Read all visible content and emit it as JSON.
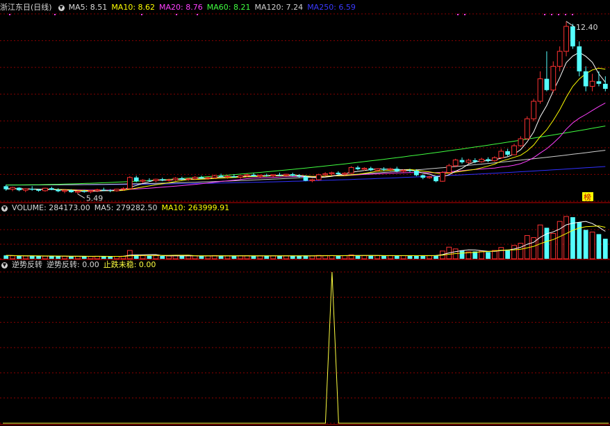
{
  "price_header": {
    "title": "浙江东日(日线)",
    "ma5": "MA5: 8.51",
    "ma10": "MA10: 8.62",
    "ma20": "MA20: 8.76",
    "ma60": "MA60: 8.21",
    "ma120": "MA120: 7.24",
    "ma250": "MA250: 6.59",
    "high_label": "12.40",
    "low_label": "5.49",
    "tag": "榜"
  },
  "volume_header": {
    "volume": "VOLUME: 284173.00",
    "ma5": "MA5: 279282.50",
    "ma10": "MA10: 263999.91"
  },
  "indicator_header": {
    "name": "逆势反转",
    "line1": "逆势反转: 0.00",
    "line2": "止跌未稳: 0.00"
  },
  "colors": {
    "up": "#ff3232",
    "down": "#54ffff",
    "grid": "#8b0000",
    "ma5": "#ffffff",
    "ma10": "#ffff00",
    "ma20": "#ff40ff",
    "ma60": "#40ff40",
    "ma120": "#d0d0d0",
    "ma250": "#3030ff",
    "signal": "#ffff40"
  },
  "chart_data": [
    {
      "type": "candlestick",
      "title": "浙江东日(日线)",
      "ylim": [
        5.2,
        12.7
      ],
      "ohlc": [
        [
          5.8,
          5.86,
          5.62,
          5.68
        ],
        [
          5.68,
          5.78,
          5.6,
          5.75
        ],
        [
          5.74,
          5.76,
          5.6,
          5.64
        ],
        [
          5.64,
          5.72,
          5.56,
          5.7
        ],
        [
          5.7,
          5.8,
          5.62,
          5.66
        ],
        [
          5.66,
          5.7,
          5.58,
          5.62
        ],
        [
          5.62,
          5.74,
          5.58,
          5.72
        ],
        [
          5.72,
          5.78,
          5.64,
          5.66
        ],
        [
          5.66,
          5.72,
          5.56,
          5.6
        ],
        [
          5.6,
          5.66,
          5.52,
          5.64
        ],
        [
          5.64,
          5.68,
          5.54,
          5.56
        ],
        [
          5.56,
          5.62,
          5.49,
          5.6
        ],
        [
          5.6,
          5.66,
          5.54,
          5.58
        ],
        [
          5.58,
          5.64,
          5.52,
          5.62
        ],
        [
          5.62,
          5.7,
          5.56,
          5.66
        ],
        [
          5.66,
          5.74,
          5.6,
          5.64
        ],
        [
          5.64,
          5.68,
          5.56,
          5.62
        ],
        [
          5.62,
          5.7,
          5.58,
          5.68
        ],
        [
          5.68,
          5.76,
          5.62,
          5.7
        ],
        [
          5.7,
          6.2,
          5.68,
          6.15
        ],
        [
          6.15,
          6.22,
          5.96,
          6.0
        ],
        [
          6.0,
          6.08,
          5.92,
          6.04
        ],
        [
          6.04,
          6.12,
          5.98,
          6.02
        ],
        [
          6.02,
          6.1,
          5.96,
          6.08
        ],
        [
          6.08,
          6.14,
          6.0,
          6.04
        ],
        [
          6.04,
          6.1,
          5.98,
          6.06
        ],
        [
          6.06,
          6.16,
          6.02,
          6.12
        ],
        [
          6.12,
          6.18,
          6.04,
          6.08
        ],
        [
          6.08,
          6.14,
          6.02,
          6.1
        ],
        [
          6.1,
          6.2,
          6.06,
          6.16
        ],
        [
          6.16,
          6.22,
          6.08,
          6.12
        ],
        [
          6.12,
          6.18,
          6.06,
          6.14
        ],
        [
          6.14,
          6.26,
          6.1,
          6.22
        ],
        [
          6.22,
          6.3,
          6.14,
          6.18
        ],
        [
          6.18,
          6.24,
          6.1,
          6.2
        ],
        [
          6.2,
          6.28,
          6.14,
          6.16
        ],
        [
          6.16,
          6.24,
          6.1,
          6.22
        ],
        [
          6.22,
          6.3,
          6.16,
          6.26
        ],
        [
          6.26,
          6.32,
          6.18,
          6.2
        ],
        [
          6.2,
          6.26,
          6.12,
          6.24
        ],
        [
          6.24,
          6.3,
          6.18,
          6.22
        ],
        [
          6.22,
          6.28,
          6.16,
          6.26
        ],
        [
          6.26,
          6.34,
          6.2,
          6.24
        ],
        [
          6.24,
          6.3,
          6.18,
          6.28
        ],
        [
          6.28,
          6.34,
          6.2,
          6.22
        ],
        [
          6.22,
          6.28,
          6.14,
          6.18
        ],
        [
          6.18,
          6.24,
          6.0,
          6.02
        ],
        [
          6.02,
          6.1,
          5.96,
          6.06
        ],
        [
          6.06,
          6.3,
          6.02,
          6.26
        ],
        [
          6.26,
          6.36,
          6.2,
          6.3
        ],
        [
          6.3,
          6.38,
          6.22,
          6.34
        ],
        [
          6.34,
          6.4,
          6.24,
          6.28
        ],
        [
          6.28,
          6.36,
          6.22,
          6.32
        ],
        [
          6.32,
          6.6,
          6.3,
          6.55
        ],
        [
          6.55,
          6.62,
          6.44,
          6.48
        ],
        [
          6.48,
          6.56,
          6.42,
          6.52
        ],
        [
          6.52,
          6.58,
          6.4,
          6.44
        ],
        [
          6.44,
          6.52,
          6.38,
          6.5
        ],
        [
          6.5,
          6.56,
          6.4,
          6.46
        ],
        [
          6.46,
          6.54,
          6.4,
          6.5
        ],
        [
          6.5,
          6.58,
          6.36,
          6.4
        ],
        [
          6.4,
          6.48,
          6.34,
          6.44
        ],
        [
          6.44,
          6.5,
          6.36,
          6.42
        ],
        [
          6.42,
          6.48,
          6.2,
          6.24
        ],
        [
          6.24,
          6.28,
          6.08,
          6.14
        ],
        [
          6.14,
          6.22,
          6.1,
          6.18
        ],
        [
          6.18,
          6.2,
          5.96,
          6.0
        ],
        [
          6.0,
          6.4,
          5.98,
          6.35
        ],
        [
          6.35,
          6.7,
          6.3,
          6.62
        ],
        [
          6.62,
          6.9,
          6.56,
          6.85
        ],
        [
          6.85,
          6.95,
          6.7,
          6.76
        ],
        [
          6.76,
          6.9,
          6.7,
          6.84
        ],
        [
          6.84,
          6.92,
          6.72,
          6.78
        ],
        [
          6.78,
          6.94,
          6.74,
          6.88
        ],
        [
          6.88,
          6.96,
          6.76,
          6.82
        ],
        [
          6.82,
          7.0,
          6.78,
          6.94
        ],
        [
          6.94,
          7.3,
          6.9,
          7.2
        ],
        [
          7.2,
          7.3,
          7.0,
          7.06
        ],
        [
          7.06,
          7.5,
          7.04,
          7.42
        ],
        [
          7.42,
          7.8,
          7.38,
          7.7
        ],
        [
          7.7,
          8.6,
          7.66,
          8.5
        ],
        [
          8.5,
          9.3,
          8.4,
          9.2
        ],
        [
          9.2,
          10.4,
          9.1,
          10.1
        ],
        [
          10.1,
          11.2,
          9.6,
          9.65
        ],
        [
          9.65,
          10.8,
          9.55,
          10.6
        ],
        [
          10.6,
          11.4,
          10.4,
          11.2
        ],
        [
          11.2,
          12.4,
          11.0,
          12.2
        ],
        [
          12.2,
          12.3,
          11.3,
          11.4
        ],
        [
          11.4,
          11.6,
          10.2,
          10.4
        ],
        [
          10.4,
          10.6,
          9.6,
          9.8
        ],
        [
          9.8,
          10.3,
          9.6,
          10.0
        ],
        [
          10.0,
          10.4,
          9.8,
          9.9
        ],
        [
          9.9,
          10.2,
          9.6,
          9.7
        ]
      ],
      "ma_last": {
        "MA5": 8.51,
        "MA10": 8.62,
        "MA20": 8.76,
        "MA60": 8.21,
        "MA120": 7.24,
        "MA250": 6.59
      },
      "high": 12.4,
      "low": 5.49
    },
    {
      "type": "bar",
      "title": "VOLUME",
      "values": [
        48000,
        42000,
        40000,
        39000,
        41000,
        36000,
        38000,
        37000,
        35000,
        36000,
        33000,
        34000,
        35000,
        33000,
        36000,
        34000,
        33000,
        35000,
        37000,
        118000,
        52000,
        45000,
        42000,
        44000,
        41000,
        40000,
        43000,
        42000,
        41000,
        44000,
        42000,
        40000,
        46000,
        43000,
        41000,
        42000,
        43000,
        45000,
        41000,
        42000,
        40000,
        43000,
        42000,
        44000,
        41000,
        40000,
        47000,
        42000,
        48000,
        46000,
        45000,
        42000,
        44000,
        55000,
        48000,
        45000,
        43000,
        44000,
        42000,
        45000,
        46000,
        44000,
        43000,
        45000,
        48000,
        44000,
        50000,
        110000,
        165000,
        140000,
        120000,
        98000,
        104000,
        110000,
        95000,
        118000,
        160000,
        130000,
        190000,
        220000,
        330000,
        300000,
        480000,
        440000,
        360000,
        530000,
        600000,
        590000,
        520000,
        410000,
        380000,
        350000,
        284173
      ],
      "ma_last": {
        "MA5": 279282.5,
        "MA10": 263999.91
      }
    },
    {
      "type": "line",
      "title": "逆势反转",
      "series": [
        {
          "name": "逆势反转",
          "values": [
            0,
            0,
            0,
            0,
            0,
            0,
            0,
            0,
            0,
            0,
            0,
            0,
            0,
            0,
            0,
            0,
            0,
            0,
            0,
            0,
            0,
            0,
            0,
            0,
            0,
            0,
            0,
            0,
            0,
            0,
            0,
            0,
            0,
            0,
            0,
            0,
            0,
            0,
            0,
            0,
            0,
            0,
            0,
            0,
            0,
            0,
            0,
            0,
            0,
            0,
            1,
            0,
            0,
            0,
            0,
            0,
            0,
            0,
            0,
            0,
            0,
            0,
            0,
            0,
            0,
            0,
            0,
            0,
            0,
            0,
            0,
            0,
            0,
            0,
            0,
            0,
            0,
            0,
            0,
            0,
            0,
            0,
            0,
            0,
            0,
            0,
            0,
            0,
            0,
            0,
            0,
            0,
            0
          ]
        },
        {
          "name": "止跌未稳",
          "values": []
        }
      ],
      "ylim": [
        0,
        1
      ]
    }
  ]
}
